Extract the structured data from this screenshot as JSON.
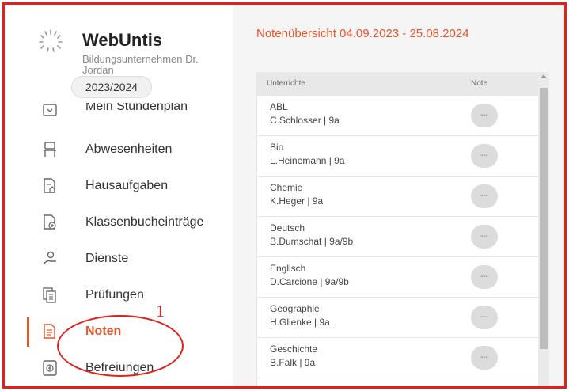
{
  "app": {
    "title": "WebUntis",
    "school": "Bildungsunternehmen Dr. Jordan",
    "year": "2023/2024"
  },
  "nav": [
    {
      "label": "Mein Stundenplan",
      "icon": "timetable-icon"
    },
    {
      "label": "Abwesenheiten",
      "icon": "chair-icon"
    },
    {
      "label": "Hausaufgaben",
      "icon": "homework-icon"
    },
    {
      "label": "Klassenbucheinträge",
      "icon": "classbook-entry-icon"
    },
    {
      "label": "Dienste",
      "icon": "duty-icon"
    },
    {
      "label": "Prüfungen",
      "icon": "exams-icon"
    },
    {
      "label": "Noten",
      "icon": "grades-icon",
      "active": true
    },
    {
      "label": "Befreiungen",
      "icon": "exemption-icon"
    }
  ],
  "annotation": {
    "number": "1"
  },
  "main": {
    "title": "Notenübersicht 04.09.2023 - 25.08.2024",
    "table": {
      "headers": [
        "Unterrichte",
        "Note"
      ],
      "rows": [
        {
          "subject": "ABL",
          "teacher": "C.Schlosser | 9a",
          "grade": "---"
        },
        {
          "subject": "Bio",
          "teacher": "L.Heinemann | 9a",
          "grade": "---"
        },
        {
          "subject": "Chemie",
          "teacher": "K.Heger | 9a",
          "grade": "---"
        },
        {
          "subject": "Deutsch",
          "teacher": "B.Dumschat | 9a/9b",
          "grade": "---"
        },
        {
          "subject": "Englisch",
          "teacher": "D.Carcione | 9a/9b",
          "grade": "---"
        },
        {
          "subject": "Geographie",
          "teacher": "H.Glienke | 9a",
          "grade": "---"
        },
        {
          "subject": "Geschichte",
          "teacher": "B.Falk | 9a",
          "grade": "---"
        }
      ]
    }
  },
  "colors": {
    "accent": "#e8542b",
    "annotation": "#e0211b"
  }
}
